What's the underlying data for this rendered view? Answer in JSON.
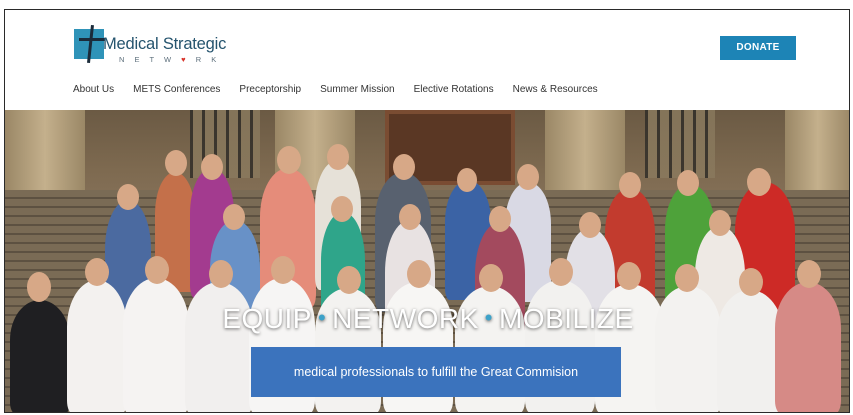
{
  "logo": {
    "title": "Medical Strategic",
    "subtitle_pre": "N E T W ",
    "subtitle_heart": "♥",
    "subtitle_post": " R K"
  },
  "header": {
    "donate_label": "DONATE"
  },
  "nav": {
    "items": [
      "About Us",
      "METS Conferences",
      "Preceptorship",
      "Summer Mission",
      "Elective Rotations",
      "News & Resources"
    ]
  },
  "hero": {
    "word1": "EQUIP",
    "word2": "NETWORK",
    "word3": "MOBILIZE",
    "subtitle": "medical professionals to fulfill the Great Commision"
  },
  "colors": {
    "accent": "#1d84b6",
    "brand": "#2f93b8",
    "subtitle_bg": "#3b73bd"
  }
}
